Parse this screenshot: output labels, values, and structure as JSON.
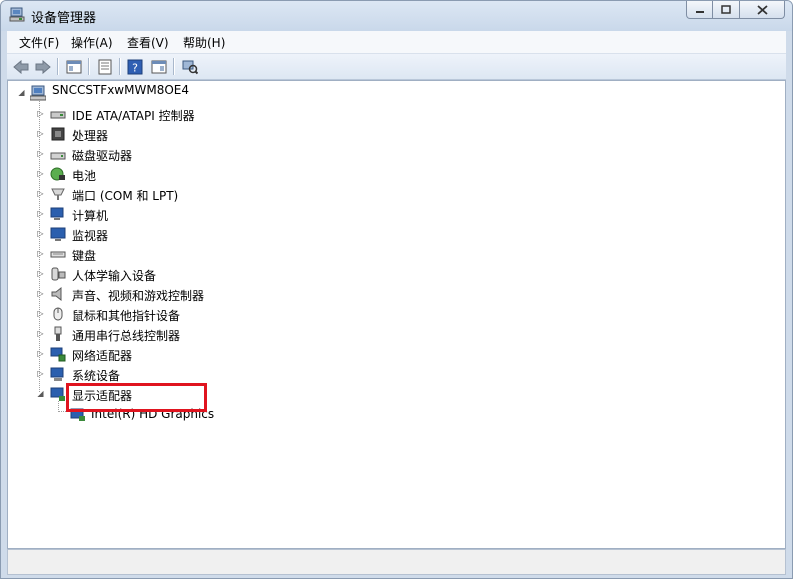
{
  "window": {
    "title": "设备管理器",
    "controls": {
      "minimize": "minimize-icon",
      "maximize": "maximize-icon",
      "close": "close-icon"
    }
  },
  "menu": [
    {
      "label": "文件(F)"
    },
    {
      "label": "操作(A)"
    },
    {
      "label": "查看(V)"
    },
    {
      "label": "帮助(H)"
    }
  ],
  "toolbar": {
    "buttons": [
      "back-arrow-icon",
      "forward-arrow-icon",
      "console-tree-icon",
      "properties-icon",
      "help-icon",
      "action-pane-icon",
      "scan-hardware-icon"
    ]
  },
  "tree": {
    "root": "SNCCSTFxwMWM8OE4",
    "categories": [
      {
        "label": "IDE ATA/ATAPI 控制器",
        "icon": "ide-controller-icon",
        "expanded": false
      },
      {
        "label": "处理器",
        "icon": "processor-icon",
        "expanded": false
      },
      {
        "label": "磁盘驱动器",
        "icon": "disk-drive-icon",
        "expanded": false
      },
      {
        "label": "电池",
        "icon": "battery-icon",
        "expanded": false
      },
      {
        "label": "端口 (COM 和 LPT)",
        "icon": "port-icon",
        "expanded": false
      },
      {
        "label": "计算机",
        "icon": "computer-icon",
        "expanded": false
      },
      {
        "label": "监视器",
        "icon": "monitor-icon",
        "expanded": false
      },
      {
        "label": "键盘",
        "icon": "keyboard-icon",
        "expanded": false
      },
      {
        "label": "人体学输入设备",
        "icon": "hid-icon",
        "expanded": false
      },
      {
        "label": "声音、视频和游戏控制器",
        "icon": "sound-icon",
        "expanded": false
      },
      {
        "label": "鼠标和其他指针设备",
        "icon": "mouse-icon",
        "expanded": false
      },
      {
        "label": "通用串行总线控制器",
        "icon": "usb-icon",
        "expanded": false
      },
      {
        "label": "网络适配器",
        "icon": "network-adapter-icon",
        "expanded": false
      },
      {
        "label": "系统设备",
        "icon": "system-device-icon",
        "expanded": false
      },
      {
        "label": "显示适配器",
        "icon": "display-adapter-icon",
        "expanded": true,
        "children": [
          {
            "label": "Intel(R) HD Graphics",
            "icon": "display-adapter-icon"
          }
        ]
      }
    ]
  },
  "highlight": {
    "target": "显示适配器",
    "color": "#e0141f"
  },
  "colors": {
    "chrome": "#cfdbea",
    "accent_border": "#8a9bb1",
    "highlight": "#e0141f"
  }
}
